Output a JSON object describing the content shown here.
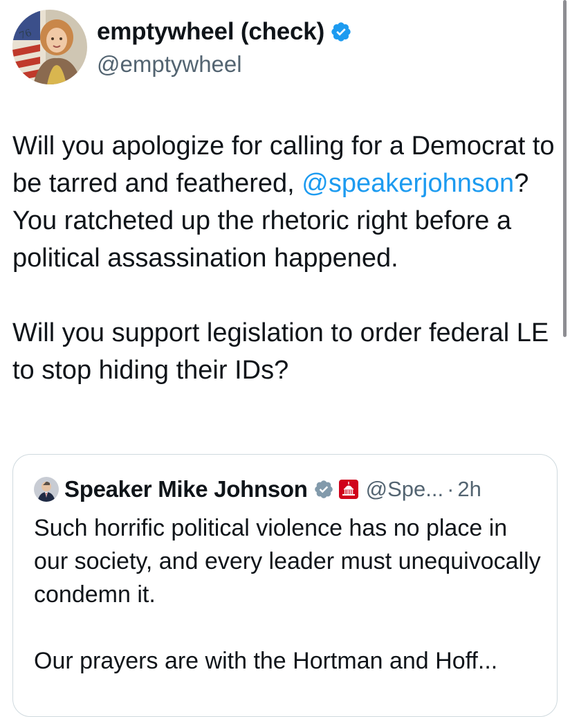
{
  "author": {
    "display_name": "emptywheel (check)",
    "handle": "@emptywheel",
    "avatar_icon": "portrait-avatar-icon",
    "verified_color": "#1d9bf0",
    "avatar_badge_text": "76"
  },
  "tweet": {
    "paragraph1_before": "Will you apologize for calling for a Democrat to be tarred and feathered, ",
    "mention": "@speakerjohnson",
    "paragraph1_after": "? You ratcheted up the rhetoric right before a political assassination happened.",
    "paragraph2": "Will you support legislation to order federal LE to stop hiding their IDs?"
  },
  "quote": {
    "display_name": "Speaker Mike Johnson",
    "handle": "@Spe...",
    "separator": "·",
    "time": "2h",
    "line1": "Such horrific political violence has no place in our society, and every leader must unequivocally condemn it.",
    "line2": "Our prayers are with the Hortman and Hoff...",
    "badge_color": "#829aab",
    "gov_icon_color": "#d0021b"
  },
  "colors": {
    "link": "#1d9bf0",
    "secondary_text": "#536471",
    "border": "#cfd9de"
  }
}
